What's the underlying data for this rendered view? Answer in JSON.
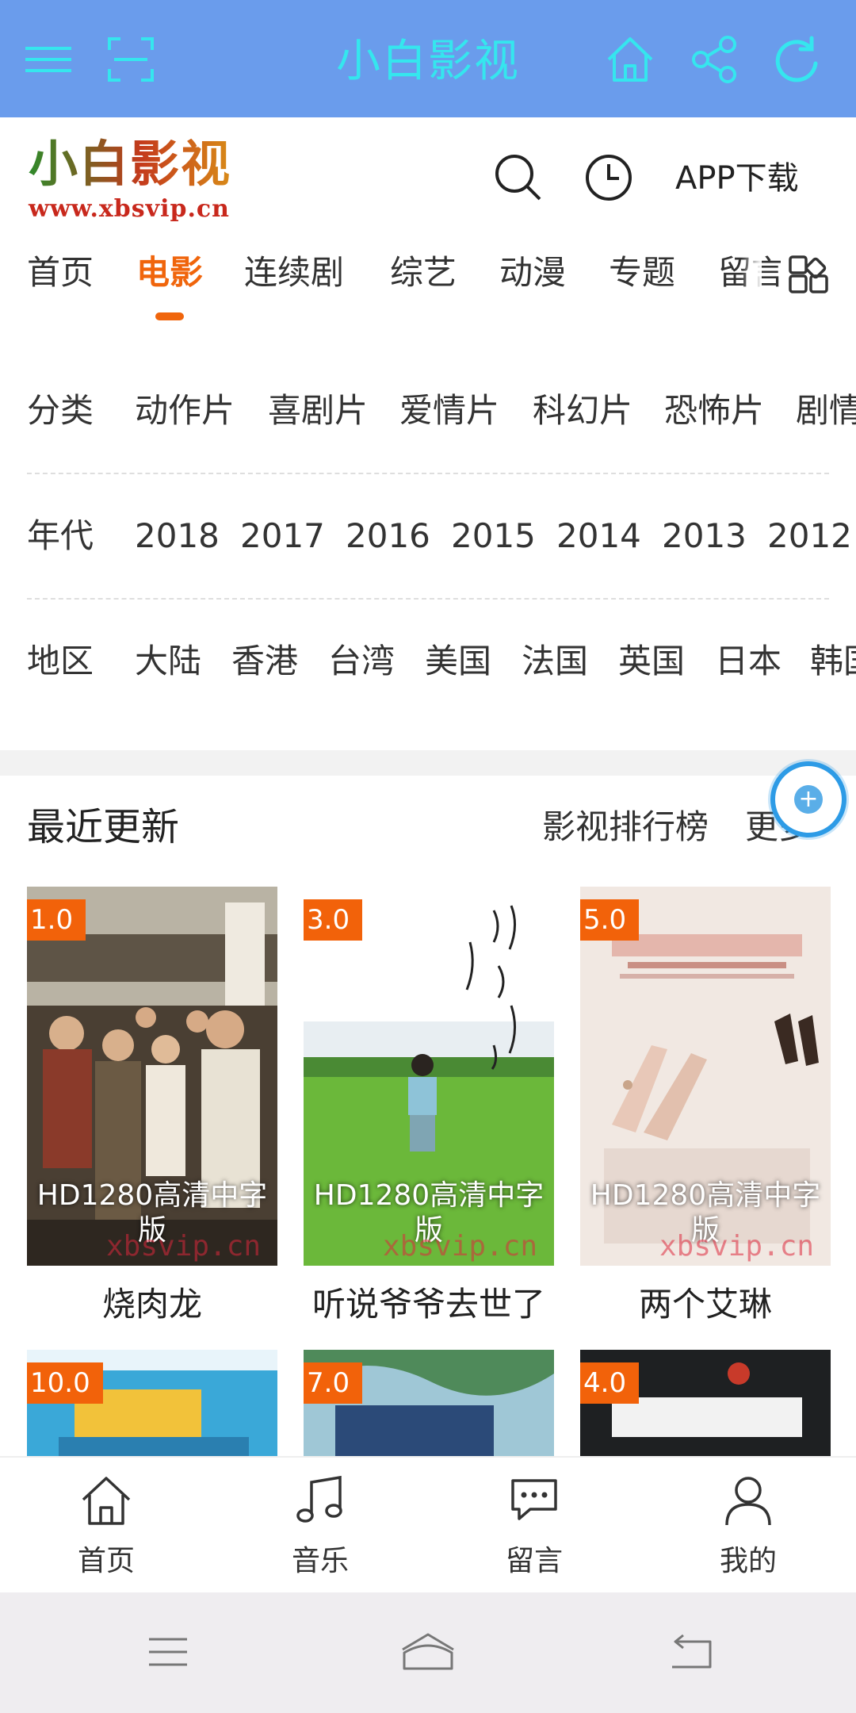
{
  "appbar": {
    "title": "小白影视",
    "icons": [
      "menu-icon",
      "scan-icon",
      "home-icon",
      "share-icon",
      "refresh-icon"
    ],
    "background": "#6a9cec",
    "accent": "#35e6ee"
  },
  "site": {
    "logo_text": "小白影视",
    "logo_url": "www.xbsvip.cn",
    "app_download": "APP下载"
  },
  "nav": {
    "tabs": [
      "首页",
      "电影",
      "连续剧",
      "综艺",
      "动漫",
      "专题",
      "留言"
    ],
    "active_tab": "电影",
    "accent": "#f0650c"
  },
  "filters": {
    "category": {
      "label": "分类",
      "options": [
        "动作片",
        "喜剧片",
        "爱情片",
        "科幻片",
        "恐怖片",
        "剧情片"
      ]
    },
    "year": {
      "label": "年代",
      "options": [
        "2018",
        "2017",
        "2016",
        "2015",
        "2014",
        "2013",
        "2012"
      ]
    },
    "region": {
      "label": "地区",
      "options": [
        "大陆",
        "香港",
        "台湾",
        "美国",
        "法国",
        "英国",
        "日本",
        "韩国"
      ]
    }
  },
  "recent": {
    "title": "最近更新",
    "ranking_link": "影视排行榜",
    "more_link": "更多",
    "watermark": "xbsvip.cn",
    "movies": [
      {
        "score": "1.0",
        "quality": "HD1280高清中字版",
        "title": "烧肉龙"
      },
      {
        "score": "3.0",
        "quality": "HD1280高清中字版",
        "title": "听说爷爷去世了"
      },
      {
        "score": "5.0",
        "quality": "HD1280高清中字版",
        "title": "两个艾琳"
      },
      {
        "score": "10.0"
      },
      {
        "score": "7.0"
      },
      {
        "score": "4.0"
      }
    ]
  },
  "bottom_nav": {
    "items": [
      {
        "label": "首页",
        "icon": "home-icon"
      },
      {
        "label": "音乐",
        "icon": "music-icon"
      },
      {
        "label": "留言",
        "icon": "chat-icon"
      },
      {
        "label": "我的",
        "icon": "user-icon"
      }
    ]
  }
}
